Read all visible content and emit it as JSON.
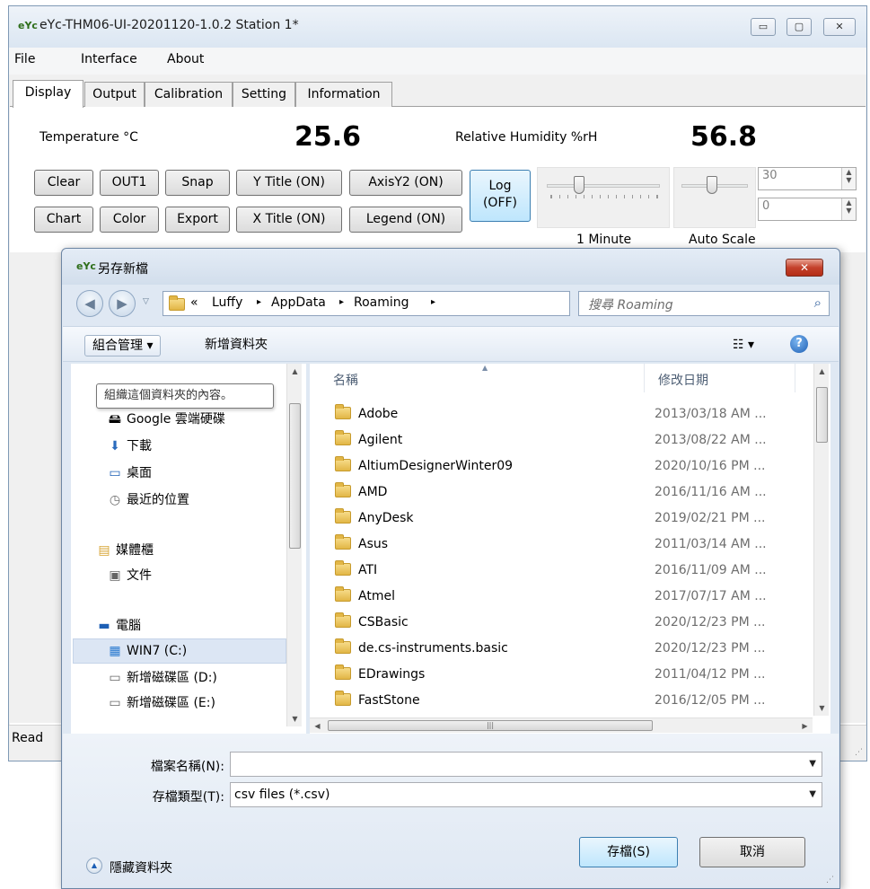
{
  "window": {
    "title": "eYc-THM06-UI-20201120-1.0.2  Station 1*",
    "logo": "eYc",
    "min_glyph": "▭",
    "max_glyph": "▢",
    "close_glyph": "✕"
  },
  "menu": {
    "file": "File",
    "interface": "Interface",
    "about": "About"
  },
  "tabs": [
    "Display",
    "Output",
    "Calibration",
    "Setting",
    "Information"
  ],
  "readings": {
    "temperature_label": "Temperature  °C",
    "temperature_value": "25.6",
    "humidity_label": "Relative Humidity  %rH",
    "humidity_value": "56.8"
  },
  "buttons": {
    "clear": "Clear",
    "out1": "OUT1",
    "snap": "Snap",
    "y_title": "Y Title (ON)",
    "axisy2": "AxisY2 (ON)",
    "chart": "Chart",
    "color": "Color",
    "export": "Export",
    "x_title": "X Title (ON)",
    "legend": "Legend (ON)",
    "log_line1": "Log",
    "log_line2": "(OFF)"
  },
  "sliders": {
    "time_label": "1 Minute",
    "scale_label": "Auto Scale"
  },
  "spinners": {
    "max": "30",
    "min": "0"
  },
  "status": {
    "text": "Read"
  },
  "dialog": {
    "title": "另存新檔",
    "close_glyph": "✕",
    "path": [
      "«",
      "Luffy",
      "AppData",
      "Roaming"
    ],
    "search_placeholder": "搜尋 Roaming",
    "organize": "組合管理 ▾",
    "new_folder": "新增資料夾",
    "view_glyph": "☷ ▾",
    "help_glyph": "?",
    "tooltip": "組織這個資料夾的內容。",
    "nav": [
      {
        "icon": "🖴",
        "label": "Google 雲端硬碟"
      },
      {
        "icon": "⬇",
        "label": "下載"
      },
      {
        "icon": "▭",
        "label": "桌面"
      },
      {
        "icon": "◷",
        "label": "最近的位置"
      },
      {
        "icon": "▤",
        "label": "媒體櫃"
      },
      {
        "icon": "▣",
        "label": "文件"
      },
      {
        "icon": "▬",
        "label": "電腦"
      },
      {
        "icon": "▦",
        "label": "WIN7 (C:)"
      },
      {
        "icon": "▭",
        "label": "新增磁碟區 (D:)"
      },
      {
        "icon": "▭",
        "label": "新增磁碟區 (E:)"
      }
    ],
    "col_name": "名稱",
    "col_date": "修改日期",
    "files": [
      {
        "name": "Adobe",
        "date": "2013/03/18 AM ..."
      },
      {
        "name": "Agilent",
        "date": "2013/08/22 AM ..."
      },
      {
        "name": "AltiumDesignerWinter09",
        "date": "2020/10/16 PM ..."
      },
      {
        "name": "AMD",
        "date": "2016/11/16 AM ..."
      },
      {
        "name": "AnyDesk",
        "date": "2019/02/21 PM ..."
      },
      {
        "name": "Asus",
        "date": "2011/03/14 AM ..."
      },
      {
        "name": "ATI",
        "date": "2016/11/09 AM ..."
      },
      {
        "name": "Atmel",
        "date": "2017/07/17 AM ..."
      },
      {
        "name": "CSBasic",
        "date": "2020/12/23 PM ..."
      },
      {
        "name": "de.cs-instruments.basic",
        "date": "2020/12/23 PM ..."
      },
      {
        "name": "EDrawings",
        "date": "2011/04/12 PM ..."
      },
      {
        "name": "FastStone",
        "date": "2016/12/05 PM ..."
      }
    ],
    "filename_label": "檔案名稱(N):",
    "filename_value": "",
    "filetype_label": "存檔類型(T):",
    "filetype_value": "csv files (*.csv)",
    "hide_folders": "隱藏資料夾",
    "save": "存檔(S)",
    "cancel": "取消"
  }
}
